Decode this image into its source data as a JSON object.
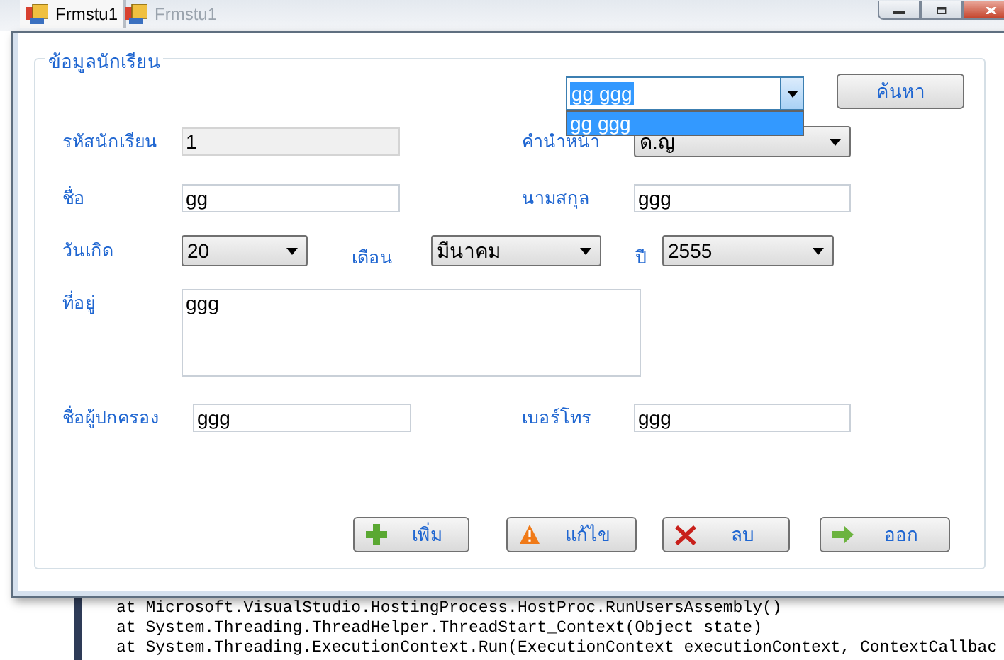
{
  "background": {
    "tabs": [
      {
        "label": "Frmstu1",
        "selected": true
      },
      {
        "label": "Frmstu1",
        "selected": false
      }
    ],
    "console_lines": [
      "at Microsoft.VisualStudio.HostingProcess.HostProc.RunUsersAssembly()",
      "at System.Threading.ThreadHelper.ThreadStart_Context(Object state)",
      "at System.Threading.ExecutionContext.Run(ExecutionContext executionContext, ContextCallbac"
    ]
  },
  "group": {
    "title": "ข้อมูลนักเรียน"
  },
  "search": {
    "value": "gg ggg",
    "text_selected": true,
    "expanded": true,
    "options": [
      {
        "label": "gg ggg",
        "selected": true
      }
    ]
  },
  "search_button": "ค้นหา",
  "rows": [
    [
      {
        "kind": "text",
        "label": "รหัสนักเรียน",
        "value": "1",
        "disabled": true
      },
      {
        "kind": "combo",
        "label": "คำนำหน้า",
        "value": "ด.ญ"
      }
    ],
    [
      {
        "kind": "text",
        "label": "ชื่อ",
        "value": "gg",
        "disabled": false
      },
      {
        "kind": "text",
        "label": "นามสกุล",
        "value": "ggg",
        "disabled": false
      }
    ],
    [
      {
        "kind": "combo",
        "label": "วันเกิด",
        "value": "20"
      },
      {
        "kind": "combo",
        "label": "เดือน",
        "value": "มีนาคม"
      },
      {
        "kind": "combo",
        "label": "ปี",
        "value": "2555"
      }
    ],
    [
      {
        "kind": "multiline",
        "label": "ที่อยู่",
        "value": "ggg",
        "disabled": false
      }
    ],
    [
      {
        "kind": "text",
        "label": "ชื่อผู้ปกครอง",
        "value": "ggg",
        "disabled": false
      },
      {
        "kind": "text",
        "label": "เบอร์โทร",
        "value": "ggg",
        "disabled": false
      }
    ]
  ],
  "buttons": [
    {
      "label": "เพิ่ม",
      "kind": "add"
    },
    {
      "label": "แก้ไข",
      "kind": "edit"
    },
    {
      "label": "ลบ",
      "kind": "delete"
    },
    {
      "label": "ออก",
      "kind": "exit"
    }
  ]
}
